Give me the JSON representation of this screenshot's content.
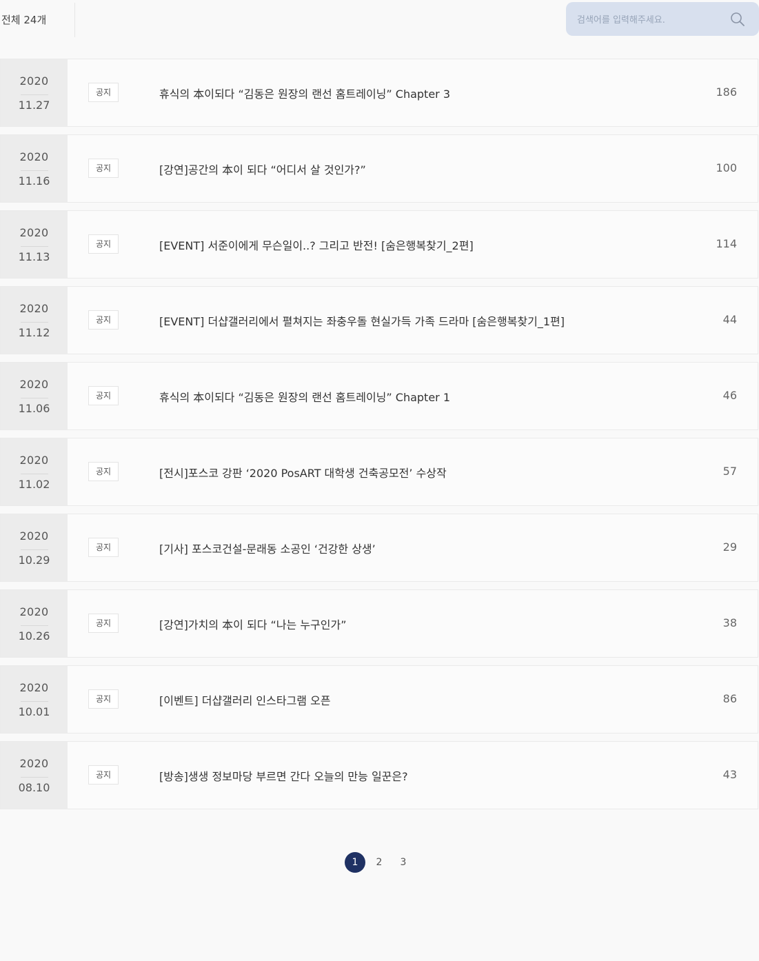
{
  "header": {
    "total_label": "전체 24개",
    "search_placeholder": "검색어를 입력해주세요."
  },
  "posts": [
    {
      "year": "2020",
      "date": "11.27",
      "badge": "공지",
      "title": "휴식의 本이되다 “김동은 원장의 랜선 홈트레이닝” Chapter 3",
      "views": "186"
    },
    {
      "year": "2020",
      "date": "11.16",
      "badge": "공지",
      "title": "[강연]공간의 本이 되다 “어디서 살 것인가?”",
      "views": "100"
    },
    {
      "year": "2020",
      "date": "11.13",
      "badge": "공지",
      "title": "[EVENT] 서준이에게 무슨일이..? 그리고 반전! [숨은행복찾기_2편]",
      "views": "114"
    },
    {
      "year": "2020",
      "date": "11.12",
      "badge": "공지",
      "title": "[EVENT] 더샵갤러리에서 펼쳐지는 좌충우돌 현실가득 가족 드라마 [숨은행복찾기_1편]",
      "views": "44"
    },
    {
      "year": "2020",
      "date": "11.06",
      "badge": "공지",
      "title": "휴식의 本이되다 “김동은 원장의 랜선 홈트레이닝” Chapter 1",
      "views": "46"
    },
    {
      "year": "2020",
      "date": "11.02",
      "badge": "공지",
      "title": "[전시]포스코 강판 ‘2020 PosART 대학생 건축공모전’ 수상작",
      "views": "57"
    },
    {
      "year": "2020",
      "date": "10.29",
      "badge": "공지",
      "title": "[기사] 포스코건설-문래동 소공인 ‘건강한 상생’",
      "views": "29"
    },
    {
      "year": "2020",
      "date": "10.26",
      "badge": "공지",
      "title": "[강연]가치의 本이 되다 “나는 누구인가”",
      "views": "38"
    },
    {
      "year": "2020",
      "date": "10.01",
      "badge": "공지",
      "title": "[이벤트] 더샵갤러리 인스타그램 오픈",
      "views": "86"
    },
    {
      "year": "2020",
      "date": "08.10",
      "badge": "공지",
      "title": "[방송]생생 정보마당 부르면 간다 오늘의 만능 일꾼은?",
      "views": "43"
    }
  ],
  "pagination": {
    "pages": [
      "1",
      "2",
      "3"
    ],
    "current": "1"
  },
  "colors": {
    "accent": "#1f3163",
    "search_bg": "#d8e0ee",
    "date_bg": "#ececec"
  },
  "icons": {
    "search": "search-icon"
  }
}
